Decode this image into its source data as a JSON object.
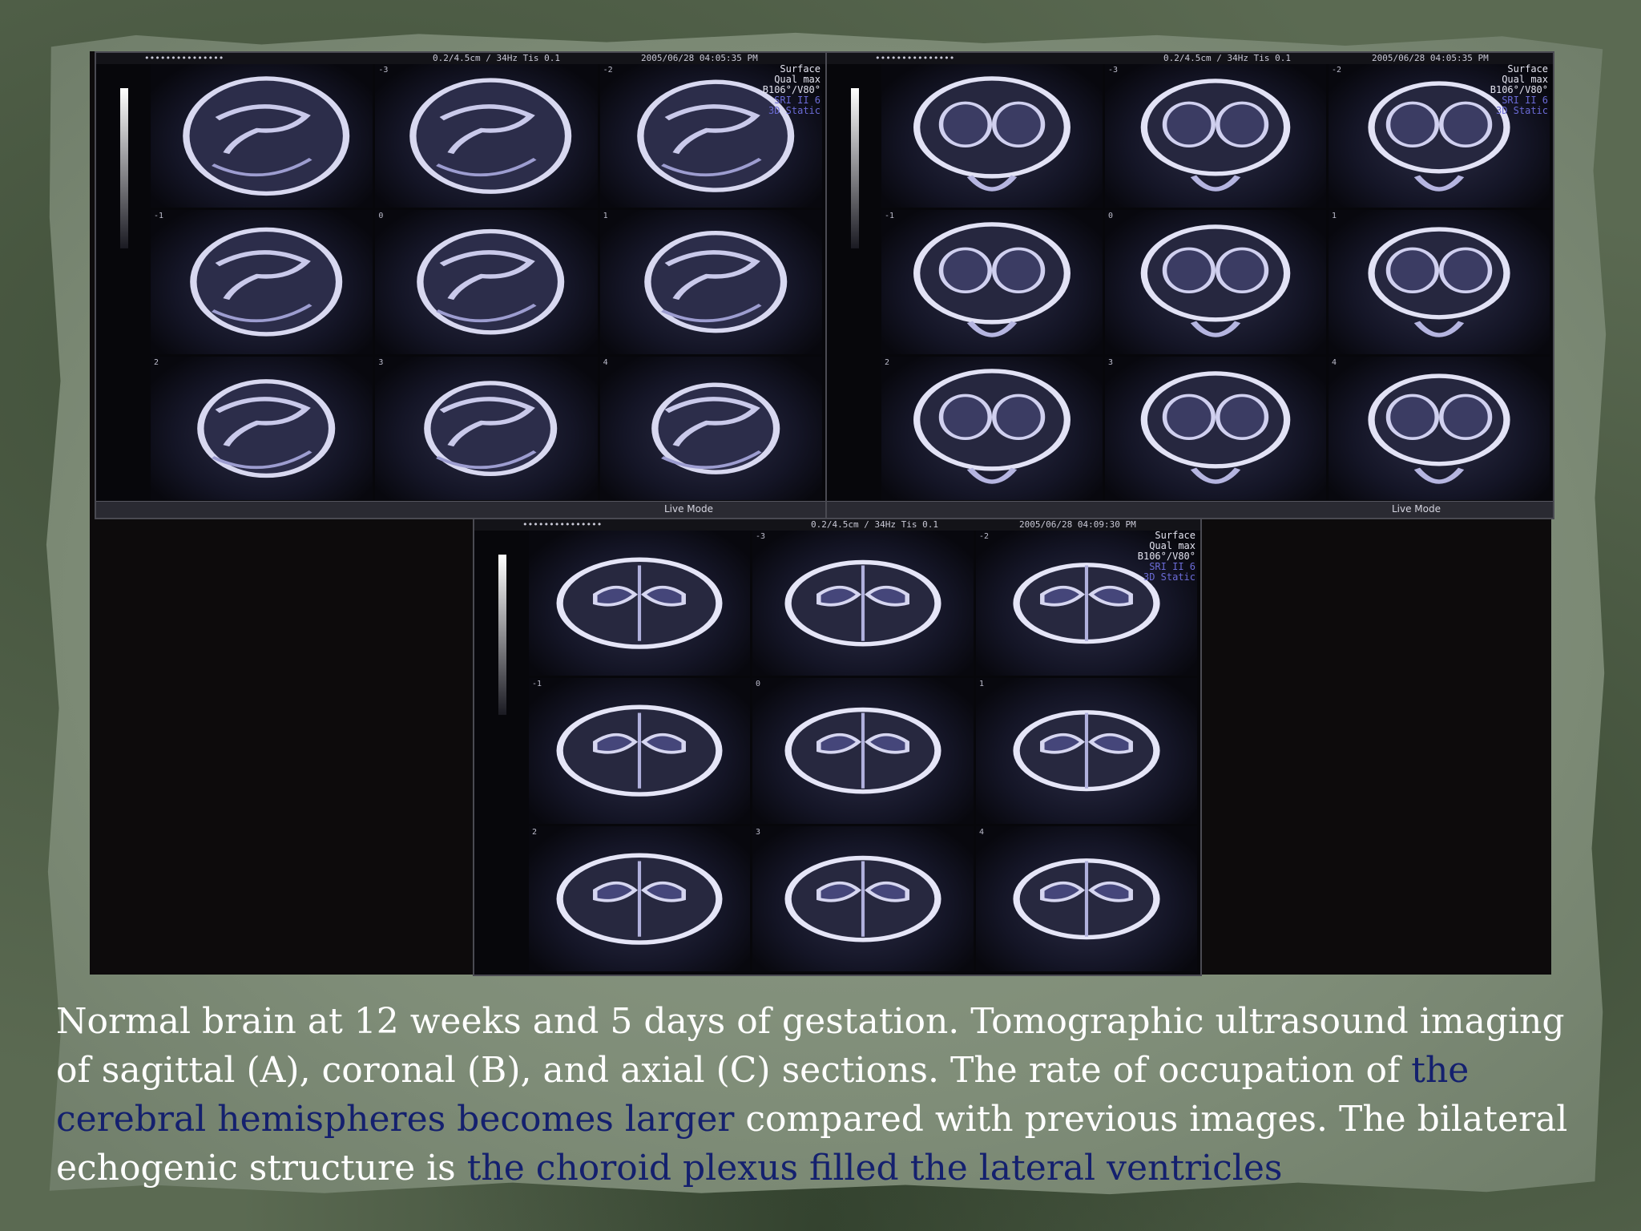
{
  "panels": {
    "a": {
      "topbar": {
        "dots": "•••••••••••••••",
        "settings": "0.2/4.5cm / 34Hz  Tis 0.1",
        "timestamp": "2005/06/28 04:05:35 PM"
      },
      "overlay": {
        "line1": "Surface",
        "line2": "Qual max",
        "line3": "B106°/V80°",
        "line4": "SRI II 6",
        "line5": "3D Static"
      },
      "status": "Live Mode"
    },
    "b": {
      "topbar": {
        "dots": "•••••••••••••••",
        "settings": "0.2/4.5cm / 34Hz  Tis 0.1",
        "timestamp": "2005/06/28 04:05:35 PM"
      },
      "overlay": {
        "line1": "Surface",
        "line2": "Qual max",
        "line3": "B106°/V80°",
        "line4": "SRI II 6",
        "line5": "3D Static"
      },
      "status": "Live Mode"
    },
    "c": {
      "topbar": {
        "dots": "•••••••••••••••",
        "settings": "0.2/4.5cm / 34Hz  Tis 0.1",
        "timestamp": "2005/06/28 04:09:30 PM"
      },
      "overlay": {
        "line1": "Surface",
        "line2": "Qual max",
        "line3": "B106°/V80°",
        "line4": "SRI II 6",
        "line5": "3D Static"
      }
    }
  },
  "slice_labels": [
    "-3",
    "-2",
    "-1",
    "0",
    "1",
    "2",
    "3",
    "4"
  ],
  "caption": {
    "part1": "Normal brain at 12 weeks and 5 days of gestation. Tomographic ultrasound imaging of sagittal (A), coronal (B), and axial (C) sections. The rate of occupation of ",
    "highlight1": "the cerebral hemispheres becomes larger",
    "part2": " compared with previous images. The bilateral echogenic structure is ",
    "highlight2": "the choroid plexus filled the lateral ventricles"
  },
  "colors": {
    "highlight_text": "#14206e",
    "background": "#5b6a52",
    "paper": "#8e9b86"
  }
}
